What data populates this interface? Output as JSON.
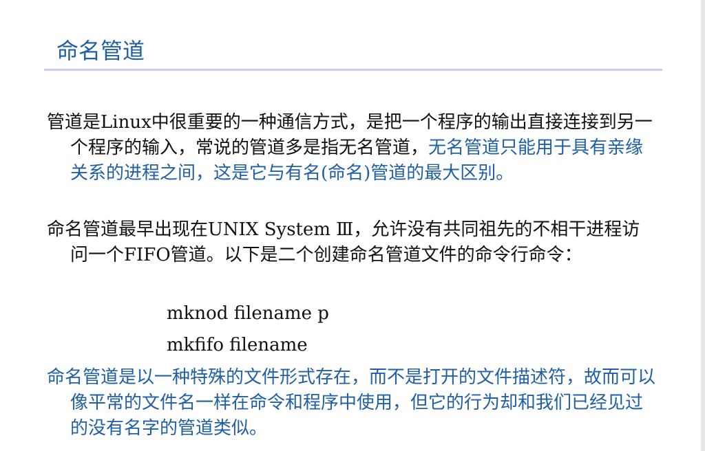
{
  "slide": {
    "title": "命名管道",
    "para1": {
      "normal": "管道是Linux中很重要的一种通信方式，是把一个程序的输出直接连接到另一个程序的输入，常说的管道多是指无名管道，",
      "highlight": "无名管道只能用于具有亲缘关系的进程之间，这是它与有名(命名)管道的最大区别。"
    },
    "para2": "命名管道最早出现在UNIX System Ⅲ，允许没有共同祖先的不相干进程访问一个FIFO管道。以下是二个创建命名管道文件的命令行命令：",
    "commands": [
      "mknod filename p",
      "mkfifo filename"
    ],
    "para3": "命名管道是以一种特殊的文件形式存在，而不是打开的文件描述符，故而可以像平常的文件名一样在命令和程序中使用，但它的行为却和我们已经见过的没有名字的管道类似。",
    "colors": {
      "accent": "#1f5fa6",
      "rule": "#c9cdf0",
      "text": "#111111"
    }
  }
}
